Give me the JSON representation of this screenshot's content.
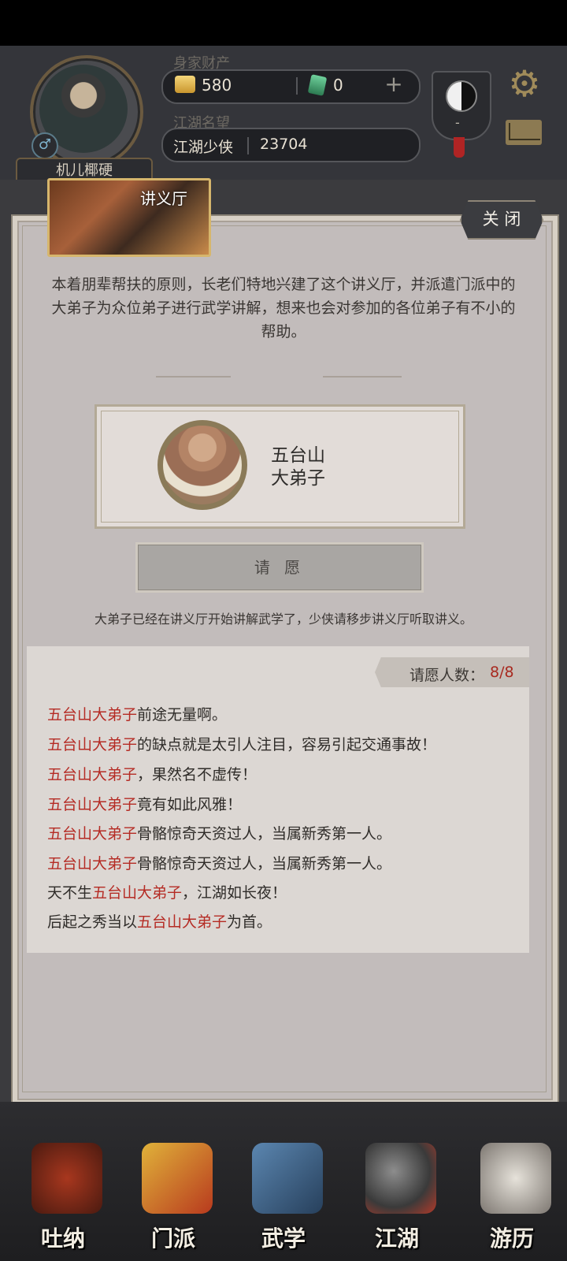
{
  "profile": {
    "name": "机儿椰硬",
    "gender_symbol": "♂",
    "wealth_label": "身家财产",
    "gold": "580",
    "jade": "0",
    "plus": "+",
    "fame_label": "江湖名望",
    "fame_title": "江湖少侠",
    "fame_value": "23704",
    "yinyang_value": "-"
  },
  "panel": {
    "hall_title": "讲义厅",
    "close_label": "关 闭",
    "description": "本着朋辈帮扶的原则，长老们特地兴建了这个讲义厅，并派遣门派中的大弟子为众位弟子进行武学讲解，想来也会对参加的各位弟子有不小的帮助。",
    "disciple_line1": "五台山",
    "disciple_line2": "大弟子",
    "wish_button": "请 愿",
    "notice": "大弟子已经在讲义厅开始讲解武学了，少侠请移步讲义厅听取讲义。",
    "count_label": "请愿人数：",
    "count_value": "8/8"
  },
  "messages": [
    {
      "pre": "",
      "hl": "五台山大弟子",
      "post": "前途无量啊。"
    },
    {
      "pre": "",
      "hl": "五台山大弟子",
      "post": "的缺点就是太引人注目，容易引起交通事故！"
    },
    {
      "pre": "",
      "hl": "五台山大弟子",
      "post": "，果然名不虚传！"
    },
    {
      "pre": "",
      "hl": "五台山大弟子",
      "post": "竟有如此风雅！"
    },
    {
      "pre": "",
      "hl": "五台山大弟子",
      "post": "骨骼惊奇天资过人，当属新秀第一人。"
    },
    {
      "pre": "",
      "hl": "五台山大弟子",
      "post": "骨骼惊奇天资过人，当属新秀第一人。"
    },
    {
      "pre": "天不生",
      "hl": "五台山大弟子",
      "post": "，江湖如长夜！"
    },
    {
      "pre": "后起之秀当以",
      "hl": "五台山大弟子",
      "post": "为首。"
    }
  ],
  "nav": {
    "tuna": "吐纳",
    "menpai": "门派",
    "wuxue": "武学",
    "jianghu": "江湖",
    "youli": "游历"
  },
  "colors": {
    "highlight": "#b52b24",
    "panel_bg": "#c2bcbb"
  }
}
